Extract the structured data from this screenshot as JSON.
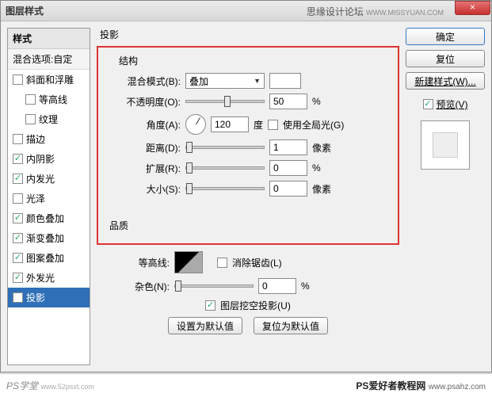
{
  "window": {
    "title": "图层样式",
    "watermark_forum": "思缘设计论坛",
    "watermark_url": "WWW.MISSYUAN.COM",
    "close": "×"
  },
  "left": {
    "header": "样式",
    "subheader": "混合选项:自定",
    "items": [
      {
        "label": "斜面和浮雕",
        "checked": false,
        "indent": false,
        "selected": false
      },
      {
        "label": "等高线",
        "checked": false,
        "indent": true,
        "selected": false
      },
      {
        "label": "纹理",
        "checked": false,
        "indent": true,
        "selected": false
      },
      {
        "label": "描边",
        "checked": false,
        "indent": false,
        "selected": false
      },
      {
        "label": "内阴影",
        "checked": true,
        "indent": false,
        "selected": false
      },
      {
        "label": "内发光",
        "checked": true,
        "indent": false,
        "selected": false
      },
      {
        "label": "光泽",
        "checked": false,
        "indent": false,
        "selected": false
      },
      {
        "label": "颜色叠加",
        "checked": true,
        "indent": false,
        "selected": false
      },
      {
        "label": "渐变叠加",
        "checked": true,
        "indent": false,
        "selected": false
      },
      {
        "label": "图案叠加",
        "checked": true,
        "indent": false,
        "selected": false
      },
      {
        "label": "外发光",
        "checked": true,
        "indent": false,
        "selected": false
      },
      {
        "label": "投影",
        "checked": true,
        "indent": false,
        "selected": true
      }
    ]
  },
  "center": {
    "main_title": "投影",
    "structure_title": "结构",
    "blendmode_label": "混合模式(B):",
    "blendmode_value": "叠加",
    "opacity_label": "不透明度(O):",
    "opacity_value": "50",
    "opacity_unit": "%",
    "angle_label": "角度(A):",
    "angle_value": "120",
    "angle_unit": "度",
    "global_light_label": "使用全局光(G)",
    "global_light_checked": false,
    "distance_label": "距离(D):",
    "distance_value": "1",
    "distance_unit": "像素",
    "spread_label": "扩展(R):",
    "spread_value": "0",
    "spread_unit": "%",
    "size_label": "大小(S):",
    "size_value": "0",
    "size_unit": "像素",
    "quality_title": "品质",
    "contour_label": "等高线:",
    "antialias_label": "消除锯齿(L)",
    "antialias_checked": false,
    "noise_label": "杂色(N):",
    "noise_value": "0",
    "noise_unit": "%",
    "knockout_label": "图层挖空投影(U)",
    "knockout_checked": true,
    "reset_default": "设置为默认值",
    "restore_default": "复位为默认值"
  },
  "right": {
    "ok": "确定",
    "reset": "复位",
    "newstyle": "新建样式(W)...",
    "preview_label": "预览(V)",
    "preview_checked": true
  },
  "footer": {
    "left_logo": "PS学堂",
    "left_url": "www.52psxt.com",
    "right_text": "PS爱好者教程网",
    "right_url": "www.psahz.com"
  },
  "slider_positions": {
    "opacity": 48,
    "distance": 0,
    "spread": 0,
    "size": 0,
    "noise": 0
  }
}
